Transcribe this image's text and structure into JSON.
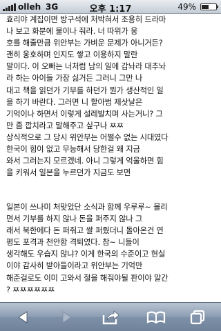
{
  "status_bar": {
    "carrier": "olleh",
    "network": "3G",
    "time": "오후 1:17",
    "battery_text": "49%",
    "battery_level": 0.49
  },
  "article": {
    "paragraph1": [
      "효리야 계집이면 방구석에 처박혀서 조용히 드라마",
      "나 보고 화분에 물이나 줘라. 너 따위가 웅",
      "호를 해줄만큼 위안부는 가벼운 문제가 아니거든?",
      "괜히 웅호하며 인지도 쌓고 이용하지 말란",
      "말이다. 이 오빠는 너처럼 남의 일에 감놔라 대추놔",
      "라 하는 아이들 가장 싫거든 그러니 그만 나",
      "대고 책을 읽던가 기부를 하던가 뭔가 생산적인 일",
      "을 하기 바란다. 그러면 니 할아범 제삿날은",
      "기억이나 하면서 이렇게 설레발치며 사는거니? 그",
      "만 좀 깝치라고 말해주고 싶구나 ㅉㅉ",
      "상식적으로 그 당시 위안부는 어쩔수 없는 시대였다",
      "한국이 힘이 없고 무능해서 당한걸 왜 지금",
      "와서 그러는지 모르겠네. 아니 그렇게 억울하면 힘",
      "을 키워서 일본을 누르던가 지금도 보면"
    ],
    "paragraph2": [
      "일본이 쓰나미 처맞았단 소식과 함께 우루루~ 몰리",
      "면서 기부를 하지 않나 돈을 퍼주지 않나 그",
      "래서 북한에다 돈 퍼줘고 쌀 퍼줬더니 돌아온건 연",
      "평도 포격과 천안함 격퇴였다. 참~ 니들이",
      "생각해도 우습지 않냐? 이게 한국의 수준이고 현실",
      "이야 감사히 받아들이라고 위안부는 기억만",
      "해준걸로도 이미 고와서 절을 해줘야될 판이야 알간",
      "? ㅉㅉㅉㅉㅉㅉ"
    ]
  },
  "toolbar": {
    "icons": [
      "back-arrow-icon",
      "forward-arrow-icon",
      "share-icon",
      "bookmarks-icon",
      "pages-icon"
    ]
  }
}
